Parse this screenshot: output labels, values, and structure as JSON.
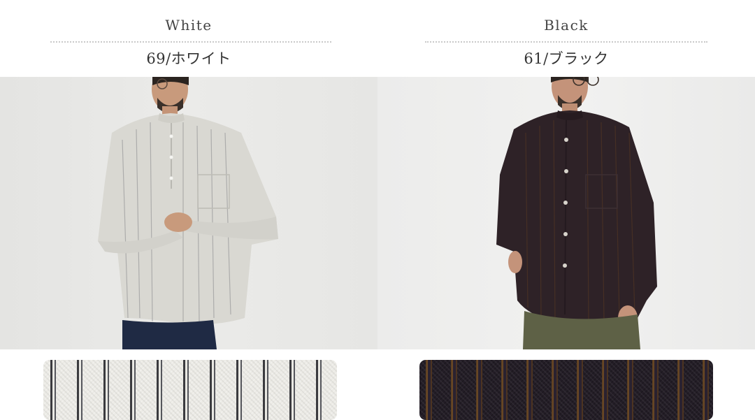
{
  "variants": [
    {
      "color_name": "White",
      "color_code": "69/ホワイト",
      "swatch_color": "#ecebe6",
      "stripe_color": "#3b3b3f"
    },
    {
      "color_name": "Black",
      "color_code": "61/ブラック",
      "swatch_color": "#231d26",
      "stripe_color": "#6e4b26"
    }
  ]
}
